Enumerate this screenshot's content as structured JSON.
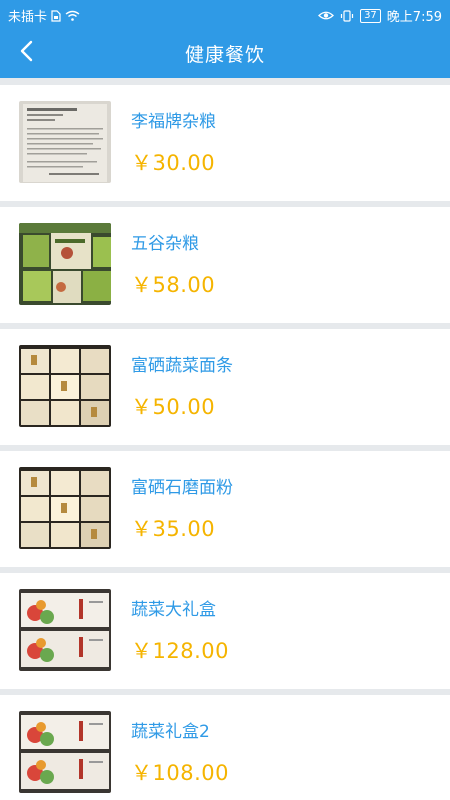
{
  "status_bar": {
    "carrier": "未插卡",
    "battery": "37",
    "time": "晚上7:59"
  },
  "header": {
    "title": "健康餐饮"
  },
  "products": [
    {
      "name": "李福牌杂粮",
      "price": "￥30.00",
      "image": "doc-image"
    },
    {
      "name": "五谷杂粮",
      "price": "￥58.00",
      "image": "boxes-image"
    },
    {
      "name": "富硒蔬菜面条",
      "price": "￥50.00",
      "image": "stacked-boxes-image"
    },
    {
      "name": "富硒石磨面粉",
      "price": "￥35.00",
      "image": "stacked-boxes-image"
    },
    {
      "name": "蔬菜大礼盒",
      "price": "￥128.00",
      "image": "gift-box-image"
    },
    {
      "name": "蔬菜礼盒2",
      "price": "￥108.00",
      "image": "gift-box-image"
    }
  ],
  "colors": {
    "header_bg": "#2f9ae6",
    "name_text": "#2f9ae6",
    "price_text": "#f5b400",
    "page_bg": "#e6e9ec"
  }
}
